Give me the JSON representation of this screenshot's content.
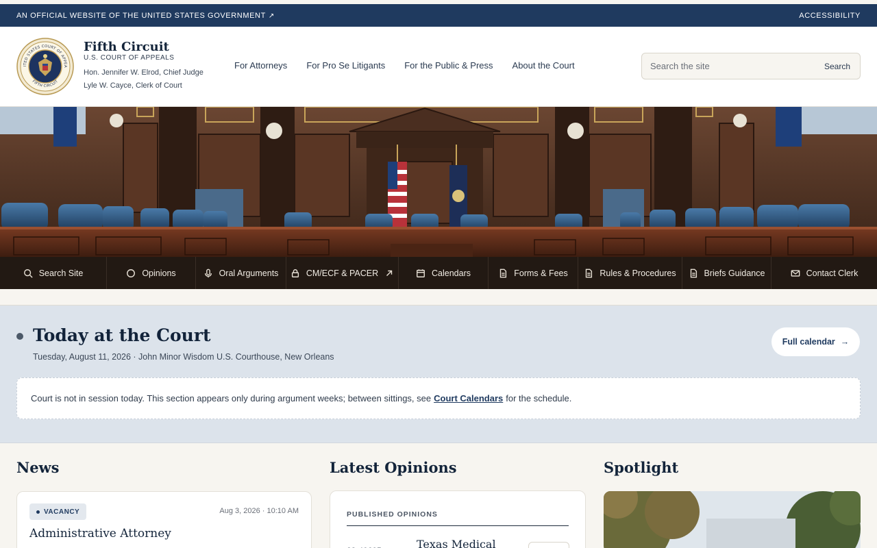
{
  "gov_banner": {
    "official_text": "AN OFFICIAL WEBSITE OF THE UNITED STATES GOVERNMENT",
    "accessibility": "ACCESSIBILITY"
  },
  "brand": {
    "title": "Fifth Circuit",
    "subtitle": "U.S. COURT OF APPEALS",
    "chief_judge": "Hon. Jennifer W. Elrod, Chief Judge",
    "clerk": "Lyle W. Cayce, Clerk of Court",
    "seal_top": "UNITED STATES COURT OF APPEALS",
    "seal_bottom": "FIFTH CIRCUIT"
  },
  "main_nav": [
    "For Attorneys",
    "For Pro Se Litigants",
    "For the Public & Press",
    "About the Court"
  ],
  "search": {
    "placeholder": "Search the site",
    "button": "Search"
  },
  "quick_nav": [
    {
      "label": "Search Site",
      "icon": "search-icon"
    },
    {
      "label": "Opinions",
      "icon": "circle-icon"
    },
    {
      "label": "Oral Arguments",
      "icon": "microphone-icon"
    },
    {
      "label": "CM/ECF & PACER",
      "icon": "lock-icon"
    },
    {
      "label": "Calendars",
      "icon": "calendar-icon"
    },
    {
      "label": "Forms & Fees",
      "icon": "document-icon"
    },
    {
      "label": "Rules & Procedures",
      "icon": "document-icon"
    },
    {
      "label": "Briefs Guidance",
      "icon": "document-icon"
    },
    {
      "label": "Contact Clerk",
      "icon": "mail-icon"
    }
  ],
  "today": {
    "title": "Today at the Court",
    "date_line": "Tuesday, August 11, 2026 · John Minor Wisdom U.S. Courthouse, New Orleans",
    "full_calendar": "Full calendar",
    "notice_before": "Court is not in session today. This section appears only during argument weeks; between sittings, see",
    "notice_link": "Court Calendars",
    "notice_after": "for the schedule."
  },
  "news": {
    "heading": "News",
    "items": [
      {
        "badge": "VACANCY",
        "time": "Aug 3, 2026 · 10:10 AM",
        "title": "Administrative Attorney"
      }
    ]
  },
  "opinions": {
    "heading": "Latest Opinions",
    "label": "PUBLISHED OPINIONS",
    "items": [
      {
        "number": "23-40605",
        "title": "Texas Medical"
      }
    ]
  },
  "spotlight": {
    "heading": "Spotlight"
  },
  "colors": {
    "gov_banner": "#1f3a5f",
    "quick_nav_bg": "#221913",
    "today_bg": "#dce3eb",
    "page_bg": "#f7f5f0"
  }
}
